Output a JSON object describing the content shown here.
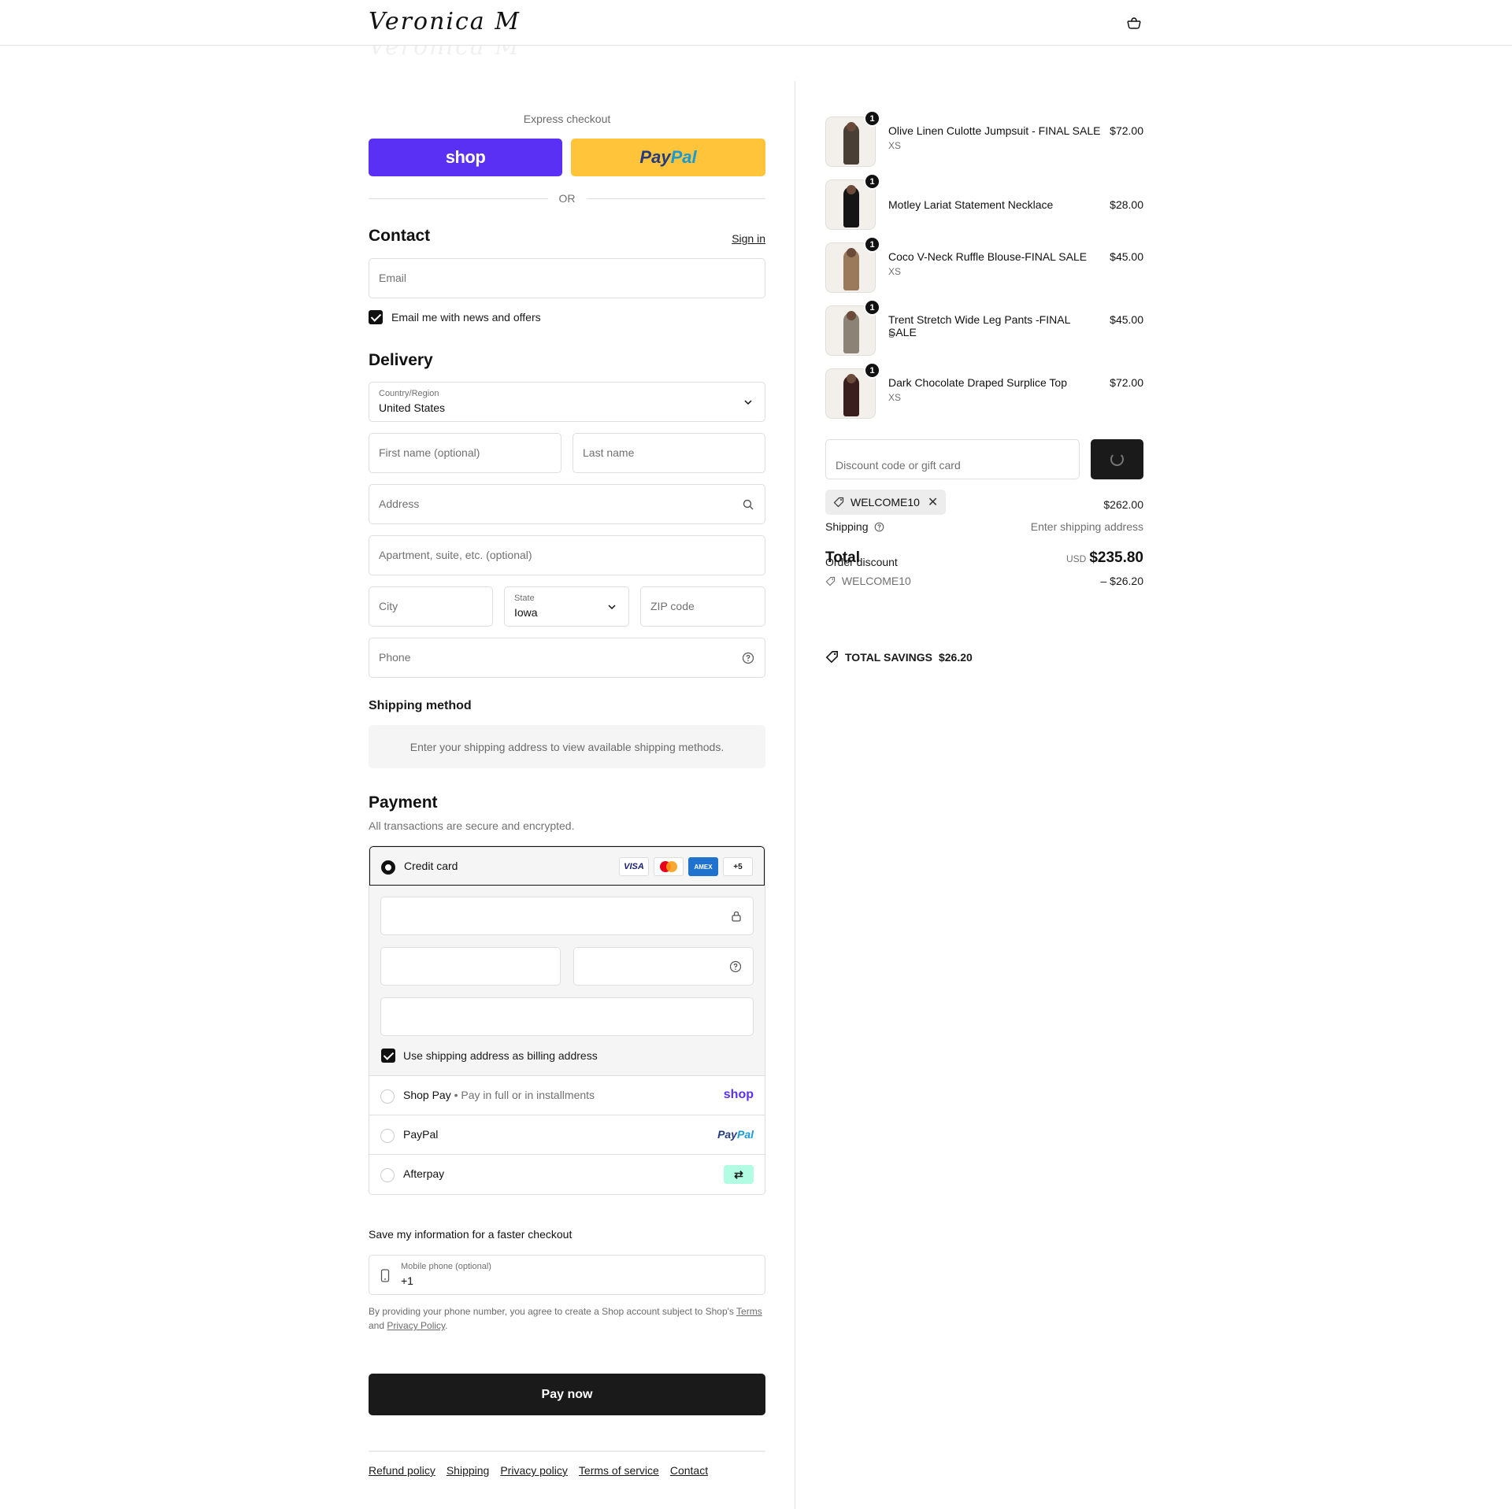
{
  "header": {
    "brand": "Veronica M",
    "cart_icon": "bag-icon"
  },
  "express": {
    "label": "Express checkout",
    "shop_label": "shop",
    "paypal_a": "Pay",
    "paypal_b": "Pal",
    "or": "OR"
  },
  "contact": {
    "title": "Contact",
    "sign_in": "Sign in",
    "email_placeholder": "Email",
    "newsletter_label": "Email me with news and offers",
    "newsletter_checked": true
  },
  "delivery": {
    "title": "Delivery",
    "country_label": "Country/Region",
    "country_value": "United States",
    "first_name_placeholder": "First name (optional)",
    "last_name_placeholder": "Last name",
    "address_placeholder": "Address",
    "apartment_placeholder": "Apartment, suite, etc. (optional)",
    "city_placeholder": "City",
    "state_label": "State",
    "state_value": "Iowa",
    "zip_placeholder": "ZIP code",
    "phone_placeholder": "Phone"
  },
  "shipping_method": {
    "title": "Shipping method",
    "message": "Enter your shipping address to view available shipping methods."
  },
  "payment": {
    "title": "Payment",
    "subtitle": "All transactions are secure and encrypted.",
    "credit_card_label": "Credit card",
    "card_brands": [
      "VISA",
      "mastercard",
      "AMEX",
      "+5"
    ],
    "billing_same_label": "Use shipping address as billing address",
    "shop_pay_label": "Shop Pay",
    "shop_pay_sub": "Pay in full or in installments",
    "shop_pay_logo": "shop",
    "paypal_label": "PayPal",
    "paypal_logo_a": "Pay",
    "paypal_logo_b": "Pal",
    "afterpay_label": "Afterpay",
    "afterpay_logo": "⇄"
  },
  "save_info": {
    "title": "Save my information for a faster checkout",
    "mobile_label": "Mobile phone (optional)",
    "mobile_value": "+1",
    "legal_prefix": "By providing your phone number, you agree to create a Shop account subject to Shop's ",
    "terms_link": "Terms",
    "legal_and": " and ",
    "privacy_link": "Privacy Policy",
    "legal_end": "."
  },
  "pay_now": "Pay now",
  "footer_links": [
    "Refund policy",
    "Shipping",
    "Privacy policy",
    "Terms of service",
    "Contact"
  ],
  "cart": {
    "items": [
      {
        "name": "Olive Linen Culotte Jumpsuit - FINAL SALE",
        "variant": "XS",
        "price": "$72.00",
        "qty": "1",
        "color": "#4a3f35"
      },
      {
        "name": "Motley Lariat Statement Necklace",
        "variant": "",
        "price": "$28.00",
        "qty": "1",
        "color": "#151515"
      },
      {
        "name": "Coco V-Neck Ruffle Blouse-FINAL SALE",
        "variant": "XS",
        "price": "$45.00",
        "qty": "1",
        "color": "#9a7a5a"
      },
      {
        "name": "Trent Stretch Wide Leg Pants -FINAL SALE",
        "variant": "S",
        "price": "$45.00",
        "qty": "1",
        "color": "#8c8275"
      },
      {
        "name": "Dark Chocolate Draped Surplice Top",
        "variant": "XS",
        "price": "$72.00",
        "qty": "1",
        "color": "#3a1e1e"
      }
    ],
    "discount_placeholder": "Discount code or gift card",
    "applied_code": "WELCOME10",
    "subtotal": "$262.00",
    "shipping_label": "Shipping",
    "shipping_value": "Enter shipping address",
    "total_label": "Total",
    "order_discount_label": "Order discount",
    "currency": "USD",
    "total": "$235.80",
    "discount_code": "WELCOME10",
    "discount_amount": "– $26.20",
    "savings_label": "TOTAL SAVINGS",
    "savings_value": "$26.20"
  }
}
